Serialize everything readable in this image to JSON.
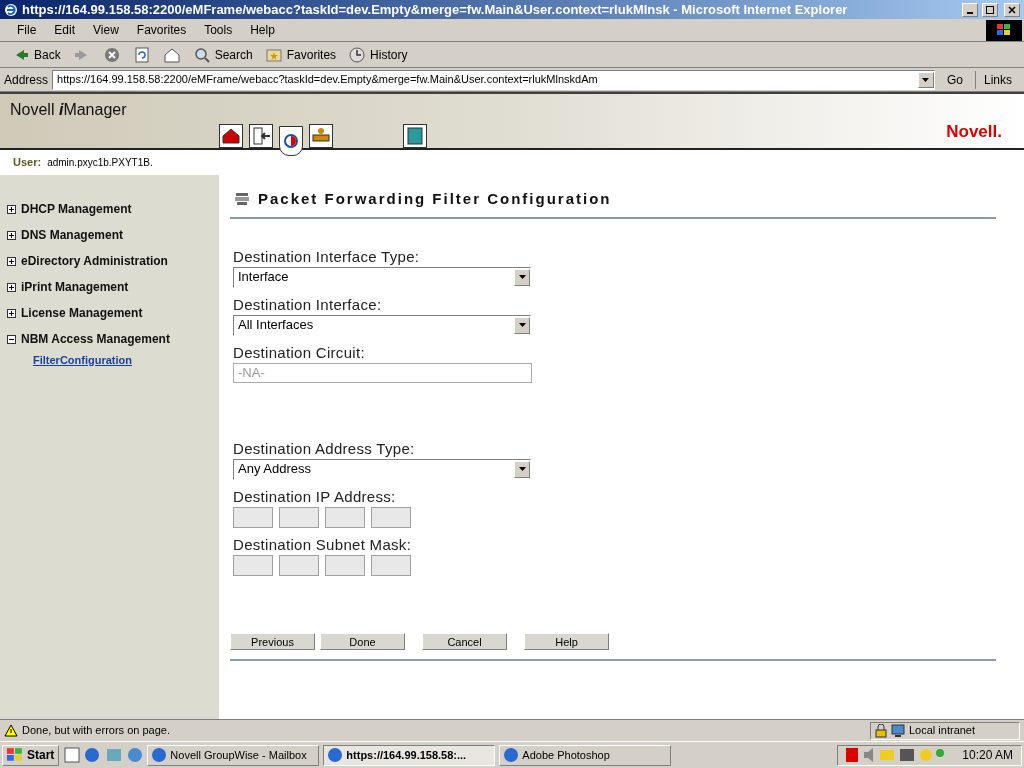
{
  "window": {
    "title": "https://164.99.158.58:2200/eMFrame/webacc?taskId=dev.Empty&merge=fw.Main&User.context=rlukMlnsk - Microsoft Internet Explorer"
  },
  "menu": [
    "File",
    "Edit",
    "View",
    "Favorites",
    "Tools",
    "Help"
  ],
  "toolbar": [
    {
      "kind": "back",
      "label": "Back"
    },
    {
      "kind": "forward"
    },
    {
      "kind": "stop"
    },
    {
      "kind": "refresh"
    },
    {
      "kind": "home"
    },
    {
      "kind": "search",
      "label": "Search"
    },
    {
      "kind": "favorites",
      "label": "Favorites"
    },
    {
      "kind": "history",
      "label": "History"
    }
  ],
  "address": {
    "label": "Address",
    "value": "https://164.99.158.58:2200/eMFrame/webacc?taskId=dev.Empty&merge=fw.Main&User.context=rlukMlnskdAm",
    "go": "Go",
    "links": "Links"
  },
  "app": {
    "brand": "Novell",
    "brand_italic": "i",
    "brand_rest": "Manager",
    "logo": "Novell.",
    "nav": [
      {
        "kind": "home",
        "selected": false
      },
      {
        "kind": "exit",
        "selected": false
      },
      {
        "kind": "roles",
        "selected": true
      },
      {
        "kind": "desk",
        "selected": false
      },
      {
        "kind": "help",
        "selected": false
      }
    ],
    "user_label": "User:",
    "user": "admin.pxyc1b.PXYT1B."
  },
  "sidebar": [
    {
      "label": "DHCP Management",
      "expanded": false
    },
    {
      "label": "DNS Management",
      "expanded": false
    },
    {
      "label": "eDirectory Administration",
      "expanded": false
    },
    {
      "label": "iPrint Management",
      "expanded": false
    },
    {
      "label": "License Management",
      "expanded": false
    },
    {
      "label": "NBM Access Management",
      "expanded": true,
      "children": [
        "FilterConfiguration"
      ]
    }
  ],
  "content": {
    "title": "Packet Forwarding Filter Configuration",
    "groups": [
      [
        {
          "kind": "select",
          "label": "Destination Interface Type:",
          "value": "Interface"
        },
        {
          "kind": "select",
          "label": "Destination Interface:",
          "value": "All Interfaces"
        },
        {
          "kind": "text",
          "label": "Destination Circuit:",
          "value": "-NA-",
          "disabled": true
        }
      ],
      [
        {
          "kind": "select",
          "label": "Destination Address Type:",
          "value": "Any Address"
        },
        {
          "kind": "ip",
          "label": "Destination IP Address:",
          "disabled": true
        },
        {
          "kind": "ip",
          "label": "Destination Subnet Mask:",
          "disabled": true
        }
      ]
    ],
    "buttons": [
      "Previous",
      "Done",
      "Cancel",
      "Help"
    ]
  },
  "status": {
    "text": "Done, but with errors on page.",
    "zone": "Local intranet"
  },
  "taskbar": {
    "start": "Start",
    "tasks": [
      {
        "label": "Novell GroupWise - Mailbox",
        "selected": false
      },
      {
        "label": "https://164.99.158.58:...",
        "selected": true
      },
      {
        "label": "Adobe Photoshop",
        "selected": false
      }
    ],
    "clock": "10:20 AM"
  }
}
